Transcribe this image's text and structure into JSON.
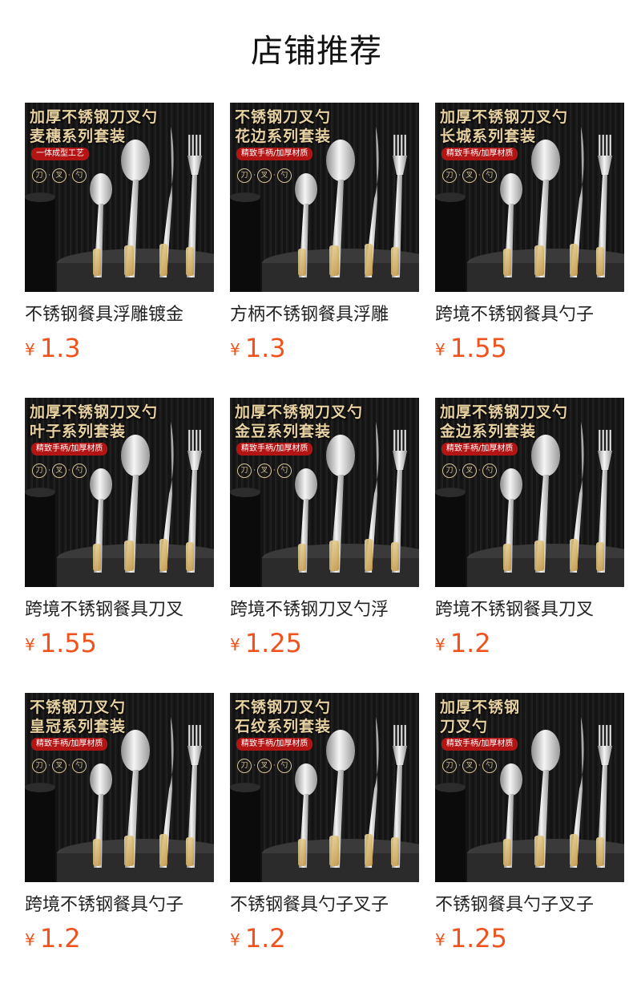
{
  "header": {
    "title": "店铺推荐"
  },
  "products": [
    {
      "image": {
        "headline_1": "加厚不锈钢刀叉勺",
        "headline_2": "麦穗系列套装",
        "tagline": "一体成型工艺",
        "badges": [
          "刀",
          "叉",
          "勺"
        ]
      },
      "name": "不锈钢餐具浮雕镀金",
      "currency": "¥",
      "price": "1.3"
    },
    {
      "image": {
        "headline_1": "不锈钢刀叉勺",
        "headline_2": "花边系列套装",
        "tagline": "精致手柄/加厚材质",
        "badges": [
          "刀",
          "叉",
          "勺"
        ]
      },
      "name": "方柄不锈钢餐具浮雕",
      "currency": "¥",
      "price": "1.3"
    },
    {
      "image": {
        "headline_1": "加厚不锈钢刀叉勺",
        "headline_2": "长城系列套装",
        "tagline": "精致手柄/加厚材质",
        "badges": [
          "刀",
          "叉",
          "勺"
        ]
      },
      "name": "跨境不锈钢餐具勺子",
      "currency": "¥",
      "price": "1.55"
    },
    {
      "image": {
        "headline_1": "加厚不锈钢刀叉勺",
        "headline_2": "叶子系列套装",
        "tagline": "精致手柄/加厚材质",
        "badges": [
          "刀",
          "叉",
          "勺"
        ]
      },
      "name": "跨境不锈钢餐具刀叉",
      "currency": "¥",
      "price": "1.55"
    },
    {
      "image": {
        "headline_1": "加厚不锈钢刀叉勺",
        "headline_2": "金豆系列套装",
        "tagline": "精致手柄/加厚材质",
        "badges": [
          "刀",
          "叉",
          "勺"
        ]
      },
      "name": "跨境不锈钢刀叉勺浮",
      "currency": "¥",
      "price": "1.25"
    },
    {
      "image": {
        "headline_1": "加厚不锈钢刀叉勺",
        "headline_2": "金边系列套装",
        "tagline": "精致手柄/加厚材质",
        "badges": [
          "刀",
          "叉",
          "勺"
        ]
      },
      "name": "跨境不锈钢餐具刀叉",
      "currency": "¥",
      "price": "1.2"
    },
    {
      "image": {
        "headline_1": "不锈钢刀叉勺",
        "headline_2": "皇冠系列套装",
        "tagline": "精致手柄/加厚材质",
        "badges": [
          "刀",
          "叉",
          "勺"
        ]
      },
      "name": "跨境不锈钢餐具勺子",
      "currency": "¥",
      "price": "1.2"
    },
    {
      "image": {
        "headline_1": "不锈钢刀叉勺",
        "headline_2": "石纹系列套装",
        "tagline": "精致手柄/加厚材质",
        "badges": [
          "刀",
          "叉",
          "勺"
        ]
      },
      "name": "不锈钢餐具勺子叉子",
      "currency": "¥",
      "price": "1.2"
    },
    {
      "image": {
        "headline_1": "加厚不锈钢",
        "headline_2": "刀叉勺",
        "tagline": "精致手柄/加厚材质",
        "badges": [
          "刀",
          "叉",
          "勺"
        ]
      },
      "name": "不锈钢餐具勺子叉子",
      "currency": "¥",
      "price": "1.25"
    }
  ],
  "colors": {
    "price": "#f0531c",
    "title": "#111111",
    "tagline_bg": "#b31414",
    "gold": "#e8d2a2"
  }
}
